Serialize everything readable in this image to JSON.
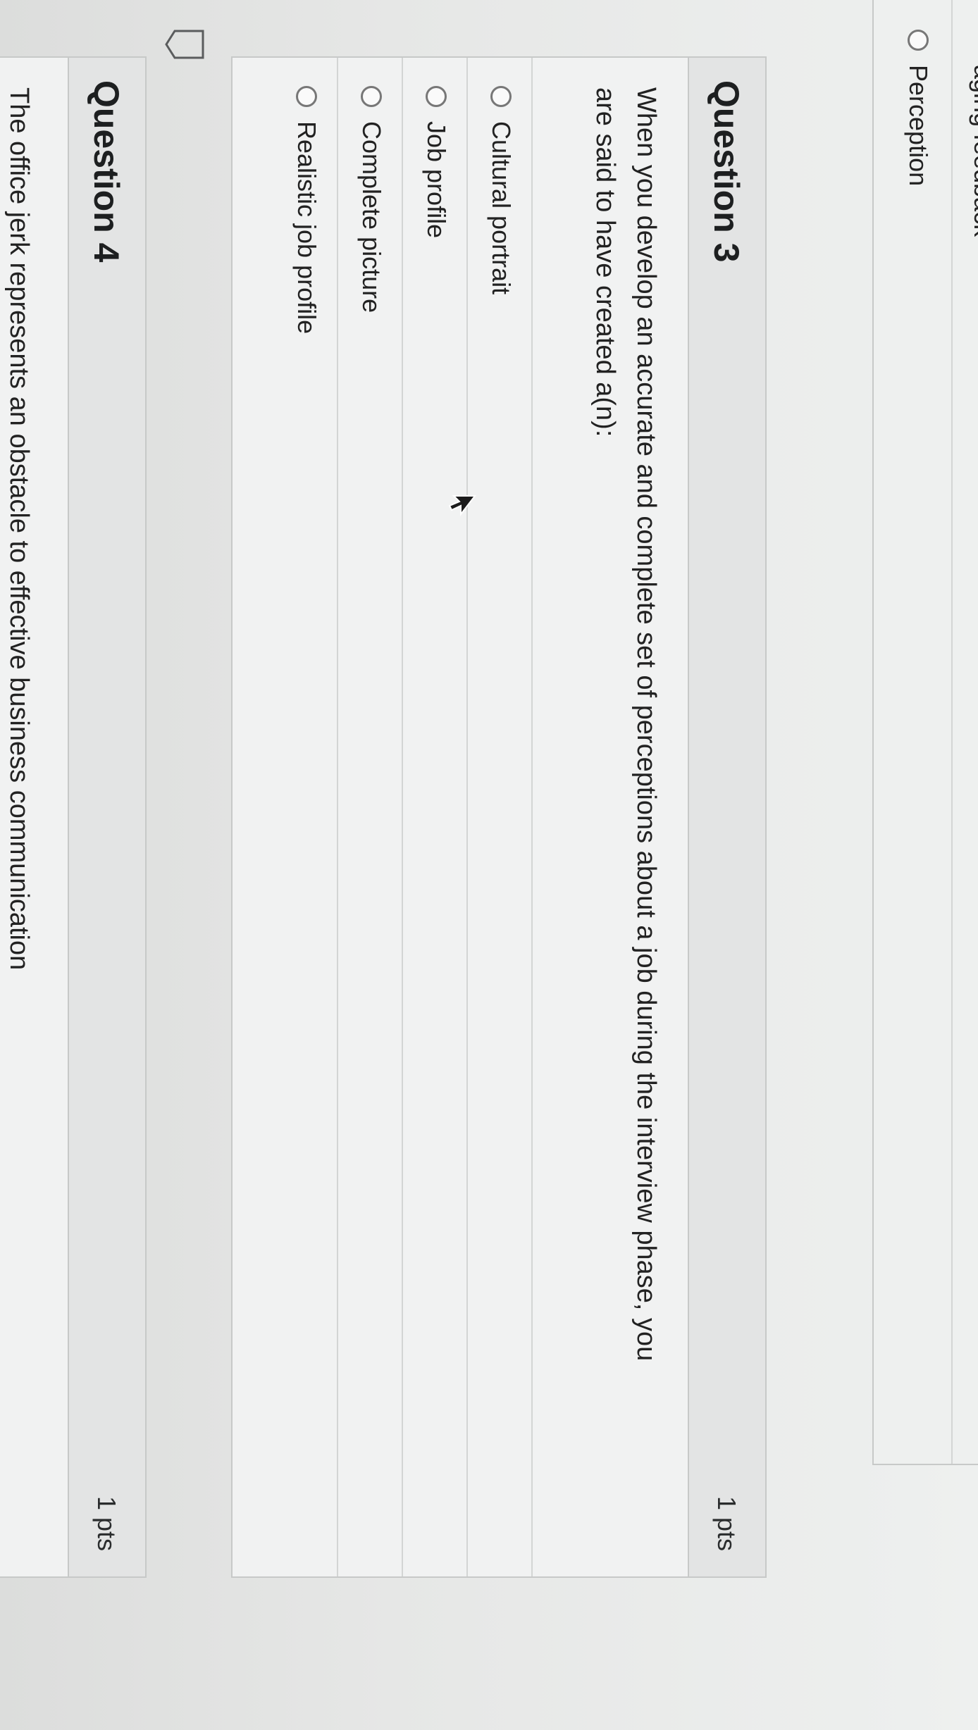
{
  "previous_question": {
    "partial_option": "aging feedback",
    "option": "Perception"
  },
  "question3": {
    "title": "Question 3",
    "points": "1 pts",
    "text": "When you develop an accurate and complete set of perceptions about a job during the interview phase, you are said to have created a(n):",
    "answers": [
      {
        "label": "Cultural portrait"
      },
      {
        "label": "Job profile"
      },
      {
        "label": "Complete picture"
      },
      {
        "label": "Realistic job profile"
      }
    ]
  },
  "question4": {
    "title": "Question 4",
    "points": "1 pts",
    "text_partial": "The office jerk represents an obstacle to effective business communication"
  },
  "icons": {
    "flag": "flag-icon",
    "cursor": "mouse-cursor-icon"
  }
}
